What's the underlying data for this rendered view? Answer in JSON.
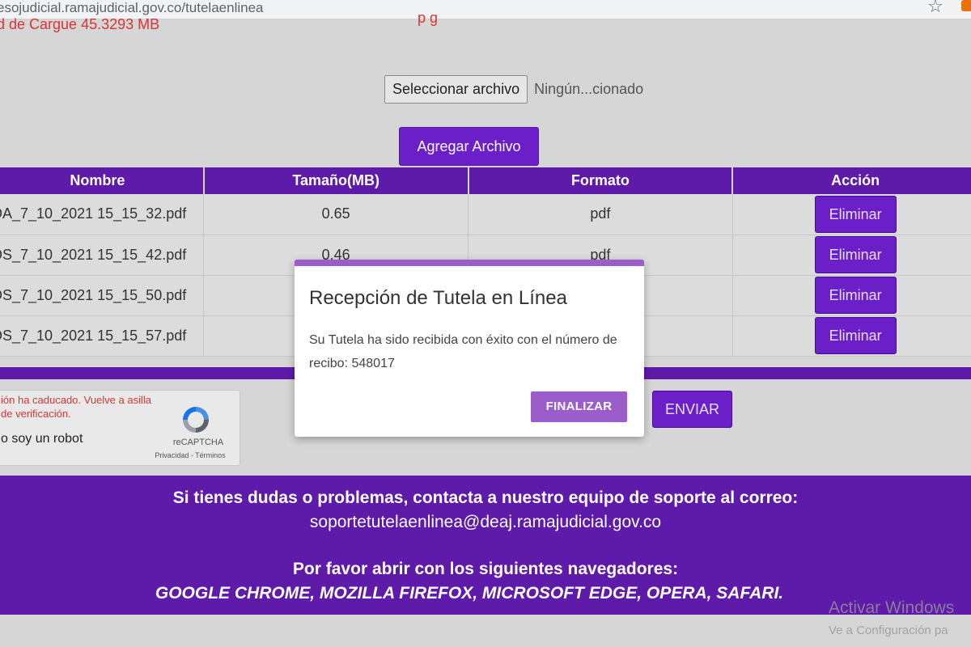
{
  "browser": {
    "url": "esojudicial.ramajudicial.gov.co/tutelaenlinea"
  },
  "upload": {
    "limit_text": "d de Cargue 45.3293 MB",
    "red_fragment": "p   g",
    "select_button": "Seleccionar archivo",
    "no_file_text": "Ningún...cionado",
    "add_button": "Agregar Archivo"
  },
  "table": {
    "headers": [
      "Nombre",
      "Tamaño(MB)",
      "Formato",
      "Acción"
    ],
    "rows": [
      {
        "name": "DA_7_10_2021 15_15_32.pdf",
        "size": "0.65",
        "format": "pdf",
        "action": "Eliminar"
      },
      {
        "name": "DS_7_10_2021 15_15_42.pdf",
        "size": "0.46",
        "format": "pdf",
        "action": "Eliminar"
      },
      {
        "name": "DS_7_10_2021 15_15_50.pdf",
        "size": "",
        "format": "",
        "action": "Eliminar"
      },
      {
        "name": "DS_7_10_2021 15_15_57.pdf",
        "size": "",
        "format": "",
        "action": "Eliminar"
      }
    ]
  },
  "captcha": {
    "error": "ión ha caducado. Vuelve a asilla de verificación.",
    "label": "o soy un robot",
    "brand": "reCAPTCHA",
    "links": "Privacidad - Términos"
  },
  "send_button": "ENVIAR",
  "footer": {
    "support_line": "Si tienes dudas o problemas, contacta a nuestro equipo de soporte al correo:",
    "support_email": "soportetutelaenlinea@deaj.ramajudicial.gov.co",
    "browsers_title": "Por favor abrir con los siguientes navegadores:",
    "browsers_list": "GOOGLE CHROME, MOZILLA FIREFOX, MICROSOFT EDGE, OPERA, SAFARI."
  },
  "windows": {
    "activate": "Activar Windows",
    "activate_sub": "Ve a Configuración pa"
  },
  "modal": {
    "title": "Recepción de Tutela en Línea",
    "body": "Su Tutela ha sido recibida con éxito con el número de recibo: 548017",
    "finish_button": "FINALIZAR"
  },
  "colors": {
    "primary_purple": "#5e1aa8",
    "button_purple": "#6a1fc8",
    "modal_accent": "#9b5dc9",
    "error_red": "#d93535"
  }
}
